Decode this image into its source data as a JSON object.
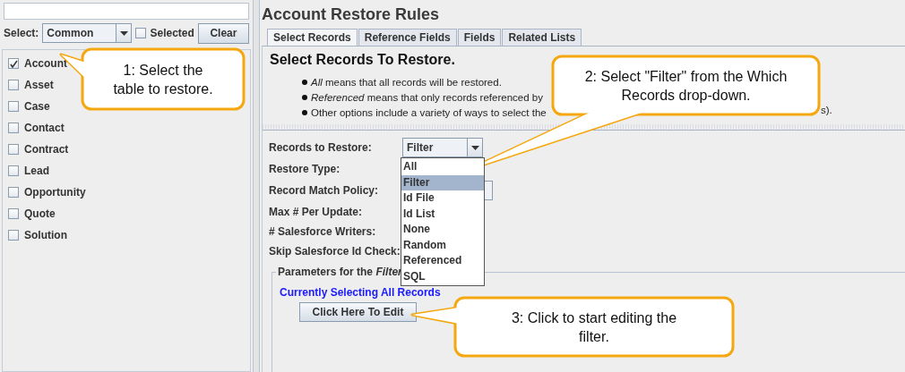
{
  "left_panel": {
    "select": {
      "label": "Select:",
      "value": "Common"
    },
    "selected_filter": {
      "label": "Selected",
      "checked": false
    },
    "clear_button": "Clear",
    "tables": [
      {
        "label": "Account",
        "checked": true
      },
      {
        "label": "Asset",
        "checked": false
      },
      {
        "label": "Case",
        "checked": false
      },
      {
        "label": "Contact",
        "checked": false
      },
      {
        "label": "Contract",
        "checked": false
      },
      {
        "label": "Lead",
        "checked": false
      },
      {
        "label": "Opportunity",
        "checked": false
      },
      {
        "label": "Quote",
        "checked": false
      },
      {
        "label": "Solution",
        "checked": false
      }
    ]
  },
  "main": {
    "title": "Account Restore Rules",
    "tabs": [
      {
        "label": "Select Records",
        "selected": true
      },
      {
        "label": "Reference Fields",
        "selected": false
      },
      {
        "label": "Fields",
        "selected": false
      },
      {
        "label": "Related Lists",
        "selected": false
      }
    ],
    "heading": "Select Records To Restore.",
    "bullets": [
      "*All* means that all records will be restored.",
      "*Referenced* means that only records referenced by",
      "Other options include a variety of ways to select the"
    ],
    "bullet_tail": "s).",
    "form": [
      {
        "label": "Records to Restore:",
        "kind": "combo",
        "value": "Filter"
      },
      {
        "label": "Restore Type:",
        "kind": "plain"
      },
      {
        "label": "Record Match Policy:",
        "kind": "combo"
      },
      {
        "label": "Max # Per Update:",
        "kind": "plain"
      },
      {
        "label": "# Salesforce Writers:",
        "kind": "plain"
      },
      {
        "label": "Skip Salesforce Id Check:",
        "kind": "plain"
      }
    ],
    "dropdown_options": [
      {
        "label": "All",
        "selected": false
      },
      {
        "label": "Filter",
        "selected": true
      },
      {
        "label": "Id File",
        "selected": false
      },
      {
        "label": "Id List",
        "selected": false
      },
      {
        "label": "None",
        "selected": false
      },
      {
        "label": "Random",
        "selected": false
      },
      {
        "label": "Referenced",
        "selected": false
      },
      {
        "label": "SQL",
        "selected": false
      }
    ],
    "parameters": {
      "legend": "Parameters for the *Filter*",
      "status": "Currently Selecting All Records",
      "edit_button": "Click Here To Edit"
    }
  },
  "callouts": [
    {
      "text": "1: Select the table to restore."
    },
    {
      "text": "2: Select \"Filter\" from the Which Records drop-down."
    },
    {
      "text": "3: Click to start editing the filter."
    }
  ]
}
